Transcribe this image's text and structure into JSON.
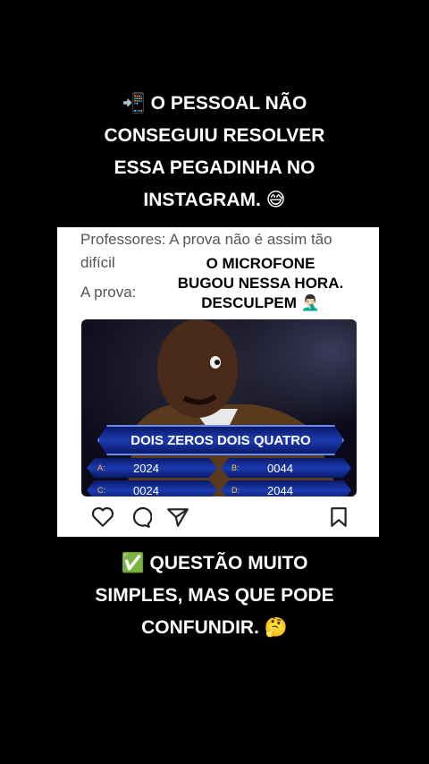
{
  "top_caption": "📲 O PESSOAL NÃO\nCONSEGUIU RESOLVER\nESSA PEGADINHA NO\nINSTAGRAM. 😅",
  "post": {
    "line1": "Professores: A prova não é assim tão",
    "line2": "difícil",
    "line3": "A prova:",
    "overlay": "O MICROFONE\nBUGOU NESSA HORA.\nDESCULPEM 🤦🏻‍♂️"
  },
  "quiz": {
    "question": "DOIS ZEROS DOIS QUATRO",
    "answers": [
      {
        "letter": "A:",
        "value": "2024"
      },
      {
        "letter": "B:",
        "value": "0044"
      },
      {
        "letter": "C:",
        "value": "0024"
      },
      {
        "letter": "D:",
        "value": "2044"
      }
    ]
  },
  "icons": [
    "heart-icon",
    "comment-icon",
    "share-icon",
    "bookmark-icon"
  ],
  "bottom_caption": "✅ QUESTÃO MUITO\nSIMPLES, MAS QUE PODE\nCONFUNDIR. 🤔"
}
